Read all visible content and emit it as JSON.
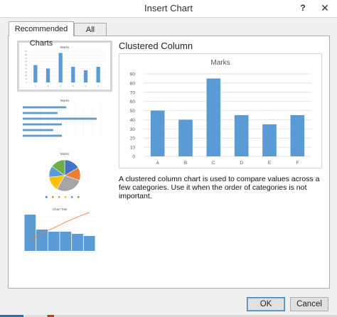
{
  "window": {
    "title": "Insert Chart",
    "help_label": "?",
    "close_label": "✕"
  },
  "tabs": [
    {
      "label": "Recommended Charts",
      "selected": true
    },
    {
      "label": "All Charts",
      "selected": false
    }
  ],
  "thumbnails": [
    {
      "name": "clustered-column",
      "title": "Marks",
      "selected": true,
      "categories": [
        "A",
        "B",
        "C",
        "D",
        "E",
        "F"
      ],
      "values": [
        50,
        40,
        85,
        45,
        35,
        45
      ]
    },
    {
      "name": "clustered-bar",
      "title": "Marks",
      "selected": false,
      "values": [
        50,
        40,
        85,
        45,
        35,
        45
      ]
    },
    {
      "name": "pie",
      "title": "Marks",
      "selected": false,
      "values": [
        50,
        40,
        85,
        45,
        35,
        45
      ],
      "colors": [
        "#4472c4",
        "#ed7d31",
        "#a5a5a5",
        "#ffc000",
        "#5b9bd5",
        "#70ad47"
      ]
    },
    {
      "name": "pareto",
      "title": "Chart Title",
      "selected": false,
      "values": [
        85,
        50,
        45,
        45,
        40,
        35
      ]
    }
  ],
  "detail": {
    "chart_type_title": "Clustered Column",
    "description": "A clustered column chart is used to compare values across a few categories. Use it when the order of categories is not important."
  },
  "chart_data": {
    "type": "bar",
    "title": "Marks",
    "categories": [
      "A",
      "B",
      "C",
      "D",
      "E",
      "F"
    ],
    "values": [
      50,
      40,
      85,
      45,
      35,
      45
    ],
    "ylim": [
      0,
      90
    ],
    "yticks": [
      0,
      10,
      20,
      30,
      40,
      50,
      60,
      70,
      80,
      90
    ],
    "grid": true,
    "xlabel": "",
    "ylabel": "",
    "bar_color": "#5b9bd5"
  },
  "buttons": {
    "ok": "OK",
    "cancel": "Cancel"
  },
  "colors": {
    "accent": "#5b9bd5",
    "line": "#ed7d31"
  }
}
